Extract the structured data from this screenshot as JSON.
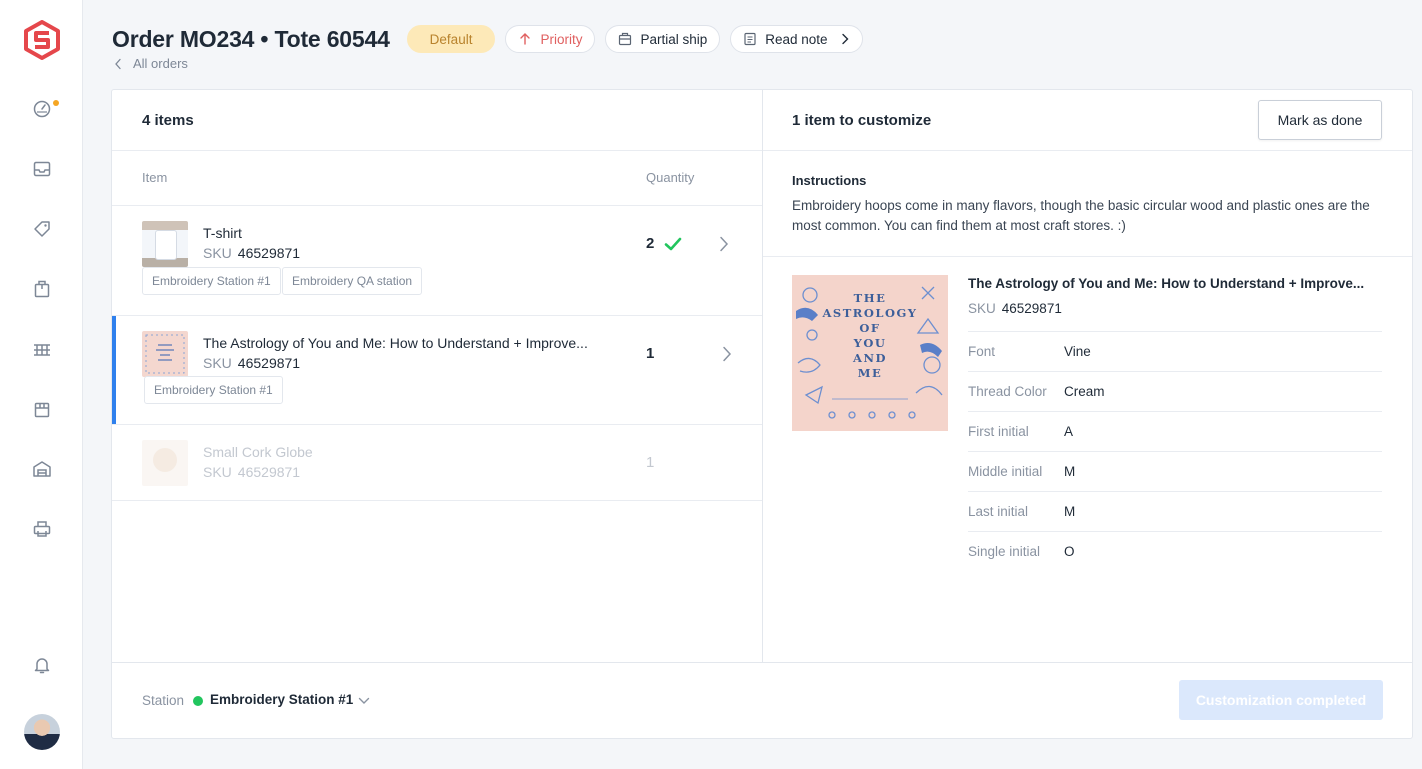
{
  "header": {
    "title": "Order MO234 • Tote 60544",
    "badge_default": "Default",
    "priority": "Priority",
    "partial_ship": "Partial ship",
    "read_note": "Read note",
    "back_link": "All orders"
  },
  "items_panel": {
    "title": "4 items",
    "col_item": "Item",
    "col_quantity": "Quantity",
    "sku_label": "SKU",
    "items": [
      {
        "name": "T-shirt",
        "sku": "46529871",
        "quantity": "2",
        "tags": [
          "Embroidery Station #1",
          "Embroidery QA station"
        ]
      },
      {
        "name": "The Astrology of You and Me: How to Understand + Improve...",
        "sku": "46529871",
        "quantity": "1",
        "tags": [
          "Embroidery Station #1"
        ]
      },
      {
        "name": "Small Cork Globe",
        "sku": "46529871",
        "quantity": "1",
        "tags": []
      }
    ]
  },
  "customize_panel": {
    "title": "1 item to customize",
    "mark_done": "Mark as done",
    "instructions_title": "Instructions",
    "instructions_text": "Embroidery hoops come in many flavors, though the basic circular wood and plastic ones are the most common. You can find them at most craft stores. :)",
    "book_cover_lines": [
      "THE",
      "ASTROLOGY",
      "OF",
      "YOU",
      "AND",
      "ME"
    ],
    "product_title": "The Astrology of You and Me: How to Understand + Improve...",
    "sku_label": "SKU",
    "sku": "46529871",
    "properties": [
      {
        "key": "Font",
        "value": "Vine"
      },
      {
        "key": "Thread Color",
        "value": "Cream"
      },
      {
        "key": "First initial",
        "value": "A"
      },
      {
        "key": "Middle initial",
        "value": "M"
      },
      {
        "key": "Last initial",
        "value": "M"
      },
      {
        "key": "Single initial",
        "value": "O"
      }
    ]
  },
  "footer": {
    "station_label": "Station",
    "station_name": "Embroidery Station #1",
    "complete_button": "Customization completed"
  },
  "colors": {
    "accent": "#2f80ed",
    "brand": "#e5474b",
    "success": "#22c55e",
    "badge_bg": "#fde9b8",
    "priority": "#e06060"
  }
}
